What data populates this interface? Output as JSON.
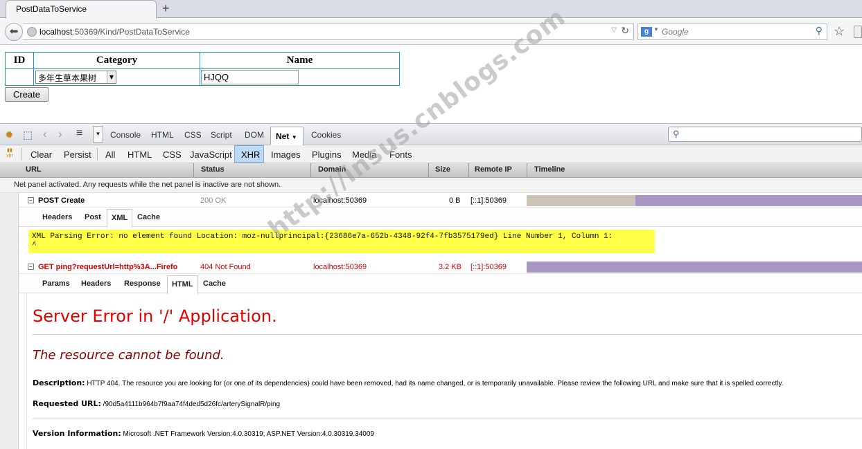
{
  "browser": {
    "tab_title": "PostDataToService",
    "new_tab": "+",
    "url_host": "localhost",
    "url_rest": ":50369/Kind/PostDataToService",
    "search_placeholder": "Google",
    "search_engine_glyph": "g"
  },
  "form": {
    "headers": [
      "ID",
      "Category",
      "Name"
    ],
    "category_value": "多年生草本果树",
    "name_value": "HJQQ",
    "create_label": "Create"
  },
  "firebug": {
    "panel_tabs": [
      "Console",
      "HTML",
      "CSS",
      "Script",
      "DOM",
      "Net",
      "Cookies"
    ],
    "active_panel": "Net",
    "filters": [
      "Clear",
      "Persist",
      "All",
      "HTML",
      "CSS",
      "JavaScript",
      "XHR",
      "Images",
      "Plugins",
      "Media",
      "Fonts"
    ],
    "active_filter": "XHR",
    "columns": [
      "URL",
      "Status",
      "Domain",
      "Size",
      "Remote IP",
      "Timeline"
    ],
    "info_line": "Net panel activated. Any requests while the net panel is inactive are not shown.",
    "requests": [
      {
        "url": "POST Create",
        "status": "200 OK",
        "domain": "localhost:50369",
        "size": "0 B",
        "remote_ip": "[::1]:50369",
        "subtabs": [
          "Headers",
          "Post",
          "XML",
          "Cache"
        ],
        "active_subtab": "XML",
        "xml_error_line1": "XML Parsing Error: no element found Location: moz-nullprincipal:{23686e7a-652b-4348-92f4-7fb3575179ed} Line Number 1, Column 1:",
        "xml_error_line2": "^"
      },
      {
        "url": "GET ping?requestUrl=http%3A...Firefo",
        "status": "404 Not Found",
        "domain": "localhost:50369",
        "size": "3.2 KB",
        "remote_ip": "[::1]:50369",
        "subtabs": [
          "Params",
          "Headers",
          "Response",
          "HTML",
          "Cache"
        ],
        "active_subtab": "HTML"
      }
    ],
    "error_page": {
      "title": "Server Error in '/' Application.",
      "subtitle": "The resource cannot be found.",
      "description_label": "Description:",
      "description_text": "HTTP 404. The resource you are looking for (or one of its dependencies) could have been removed, had its name changed, or is temporarily unavailable.  Please review the following URL and make sure that it is spelled correctly.",
      "requested_url_label": "Requested URL:",
      "requested_url_value": "/90d5a4111b964b7f9aa74f4ded5d26fc/arterySignalR/ping",
      "version_label": "Version Information:",
      "version_value": "Microsoft .NET Framework Version:4.0.30319; ASP.NET Version:4.0.30319.34009"
    }
  },
  "watermark": "http://insus.cnblogs.com"
}
